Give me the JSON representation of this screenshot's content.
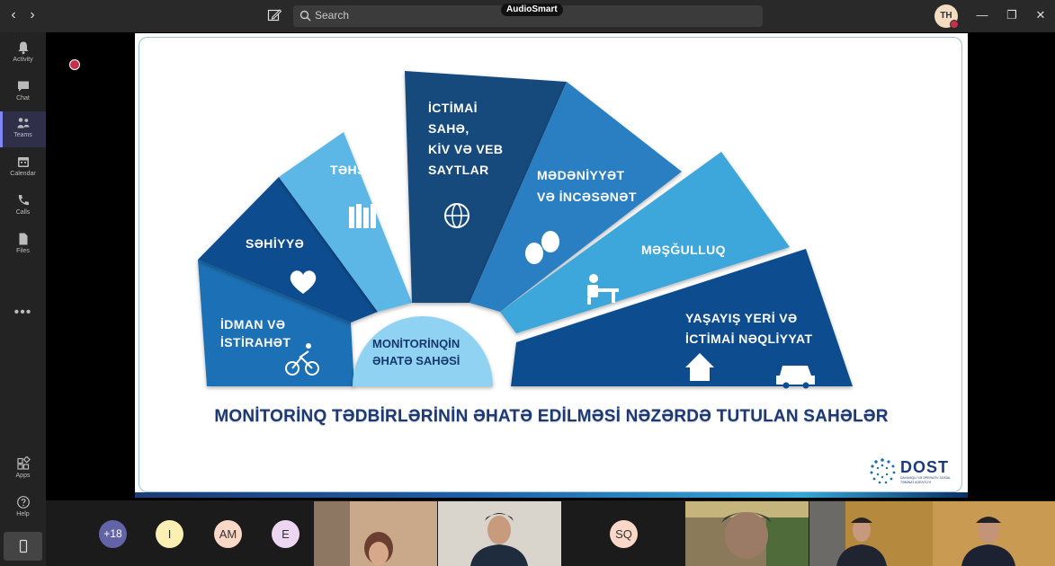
{
  "titlebar": {
    "back": "‹",
    "forward": "›",
    "search_placeholder": "Search",
    "recorder_badge": "AudioSmart",
    "user_initials": "TH",
    "win_min": "—",
    "win_max": "❐",
    "win_close": "✕"
  },
  "rail": {
    "items": [
      {
        "label": "Activity",
        "icon": "bell-icon"
      },
      {
        "label": "Chat",
        "icon": "chat-icon"
      },
      {
        "label": "Teams",
        "icon": "teams-icon"
      },
      {
        "label": "Calendar",
        "icon": "calendar-icon"
      },
      {
        "label": "Calls",
        "icon": "phone-icon"
      },
      {
        "label": "Files",
        "icon": "file-icon"
      },
      {
        "label": "Apps",
        "icon": "apps-icon"
      },
      {
        "label": "Help",
        "icon": "help-icon"
      }
    ],
    "more": "•••"
  },
  "slide": {
    "segments": {
      "idman": "İDMAN VƏ\nİSTİRAHƏT",
      "sehiyye": "SƏHİYYƏ",
      "tehsil": "TƏHSİL",
      "ictimai": "İCTİMAİ\nSAHƏ,\nKİV VƏ VEB\nSAYTLAR",
      "medeniyyet": "MƏDƏNİYYƏT\nVƏ İNCƏSƏNƏT",
      "mesgulluq": "MƏŞĞULLUQ",
      "yasayis": "YAŞAYIŞ YERİ VƏ\nİCTİMAİ NƏQLİYYAT"
    },
    "center": "MONİTORİNQİN\nƏHATƏ SAHƏSİ",
    "title": "MONİTORİNQ TƏDBİRLƏRİNİN ƏHATƏ EDİLMƏSİ NƏZƏRDƏ TUTULAN SAHƏLƏR",
    "logo_text": "DOST",
    "logo_sub": "DAYANIQLI VƏ OPERATİV SOSİAL TƏMİNAT AGENTLİYİ"
  },
  "participants": {
    "overflow": "+18",
    "avatars": [
      {
        "initials": "I",
        "color": "#fcefb4"
      },
      {
        "initials": "AM",
        "color": "#f9d8c8"
      },
      {
        "initials": "E",
        "color": "#ecd6f2"
      },
      {
        "initials": "SQ",
        "color": "#f9d8c8"
      }
    ]
  }
}
